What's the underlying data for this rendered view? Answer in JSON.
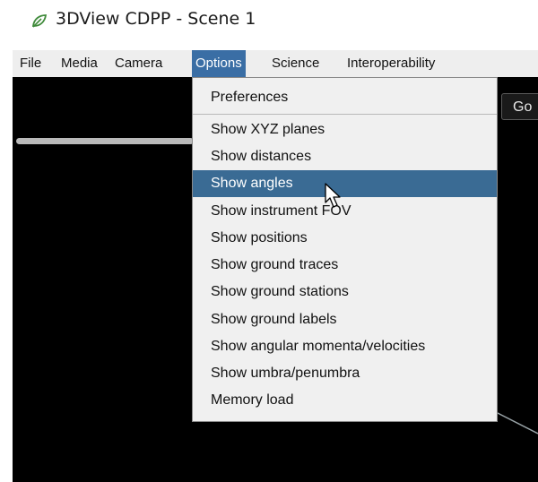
{
  "window": {
    "title": "3DView CDPP - Scene 1",
    "icon": "leaf-app-icon"
  },
  "menubar": {
    "items": [
      "File",
      "Media",
      "Camera",
      "Options",
      "Science",
      "Interoperability"
    ],
    "active": "Options"
  },
  "viewport": {
    "go_label": "Go"
  },
  "options_menu": {
    "items": [
      "Preferences",
      "Show XYZ planes",
      "Show distances",
      "Show angles",
      "Show instrument FOV",
      "Show positions",
      "Show ground traces",
      "Show ground stations",
      "Show ground labels",
      "Show angular momenta/velocities",
      "Show umbra/penumbra",
      "Memory load"
    ],
    "highlighted": "Show angles"
  },
  "colors": {
    "menu_active": "#3a6ea5",
    "item_highlight": "#3a6b94",
    "viewport_bg": "#000000",
    "icon_green": "#3f8a3a"
  }
}
